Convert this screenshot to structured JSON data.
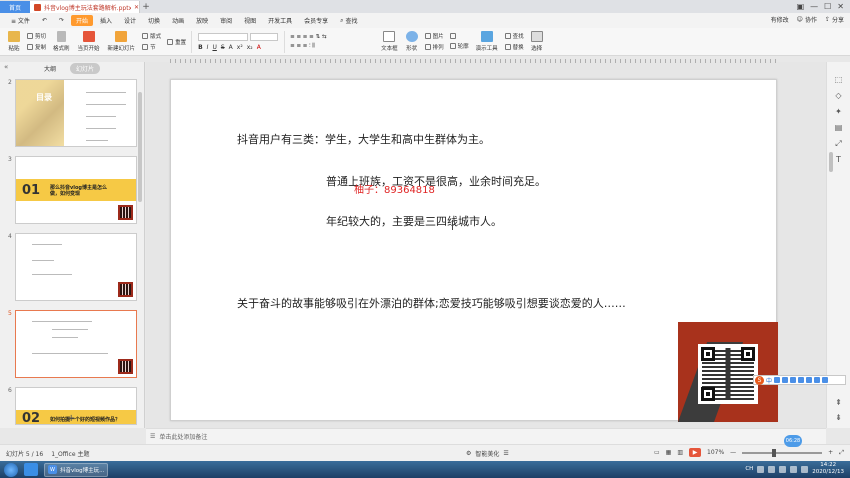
{
  "titlebar": {
    "home_tab": "首页",
    "doc_tab": "抖音vlog博主玩法套路解析.pptx",
    "new_tab": "+",
    "window_controls": [
      "▣",
      "—",
      "☐",
      "✕"
    ]
  },
  "menubar": {
    "file": "≡ 文件",
    "items": [
      "开始",
      "插入",
      "设计",
      "切换",
      "动画",
      "放映",
      "审阅",
      "视图",
      "开发工具",
      "会员专享"
    ],
    "search": "查找",
    "right": [
      "有修改",
      "协作",
      "分享"
    ]
  },
  "ribbon": {
    "paste": "粘贴",
    "cut": "剪切",
    "copy": "复制",
    "format_painter": "格式刷",
    "from_current": "当页开始",
    "new_slide": "新建幻灯片",
    "layout": "版式",
    "section": "节",
    "reset": "重置",
    "textbox": "文本框",
    "shape": "形状",
    "picture": "图片",
    "arrange": "排列",
    "outline": "轮廓",
    "present_tools": "演示工具",
    "find": "查找",
    "replace": "替换",
    "select": "选择",
    "format_chars": [
      "B",
      "I",
      "U",
      "S",
      "A",
      "x²",
      "x₂",
      "A"
    ]
  },
  "left_panel": {
    "collapse": "«",
    "tab_outline": "大纲",
    "tab_slides": "幻灯片",
    "add_slide": "+",
    "slides": [
      {
        "num": "2",
        "title": "目录"
      },
      {
        "num": "3",
        "big": "01",
        "title": "那么抖音vlog博主是怎么做，如何变现"
      },
      {
        "num": "4"
      },
      {
        "num": "5"
      },
      {
        "num": "6",
        "big": "02",
        "title": "如何拍摄一个好的短视频作品？"
      }
    ]
  },
  "slide": {
    "line1": "抖音用户有三类：学生，大学生和高中生群体为主。",
    "line2": "普通上班族，工资不是很高，业余时间充足。",
    "watermark": "柚子：89364818",
    "line3": "年纪较大的，主要是三四线城市人。",
    "line4": "关于奋斗的故事能够吸引在外漂泊的群体;恋爱技巧能够吸引想要谈恋爱的人……"
  },
  "ime": {
    "label": "中"
  },
  "notes": {
    "placeholder": "单击此处添加备注"
  },
  "status": {
    "slide_count": "幻灯片 5 / 16",
    "theme": "1_Office 主题",
    "beautify": "智能美化",
    "zoom": "107%",
    "time_bubble": "06:28"
  },
  "taskbar": {
    "app": "抖音vlog博主玩...",
    "tray_lang": "CH",
    "time": "14:22",
    "date": "2020/12/13"
  },
  "colors": {
    "accent": "#ff9a2e",
    "watermark": "#e02424",
    "qr_bg": "#a8321c",
    "slide_yellow": "#f6c945"
  }
}
